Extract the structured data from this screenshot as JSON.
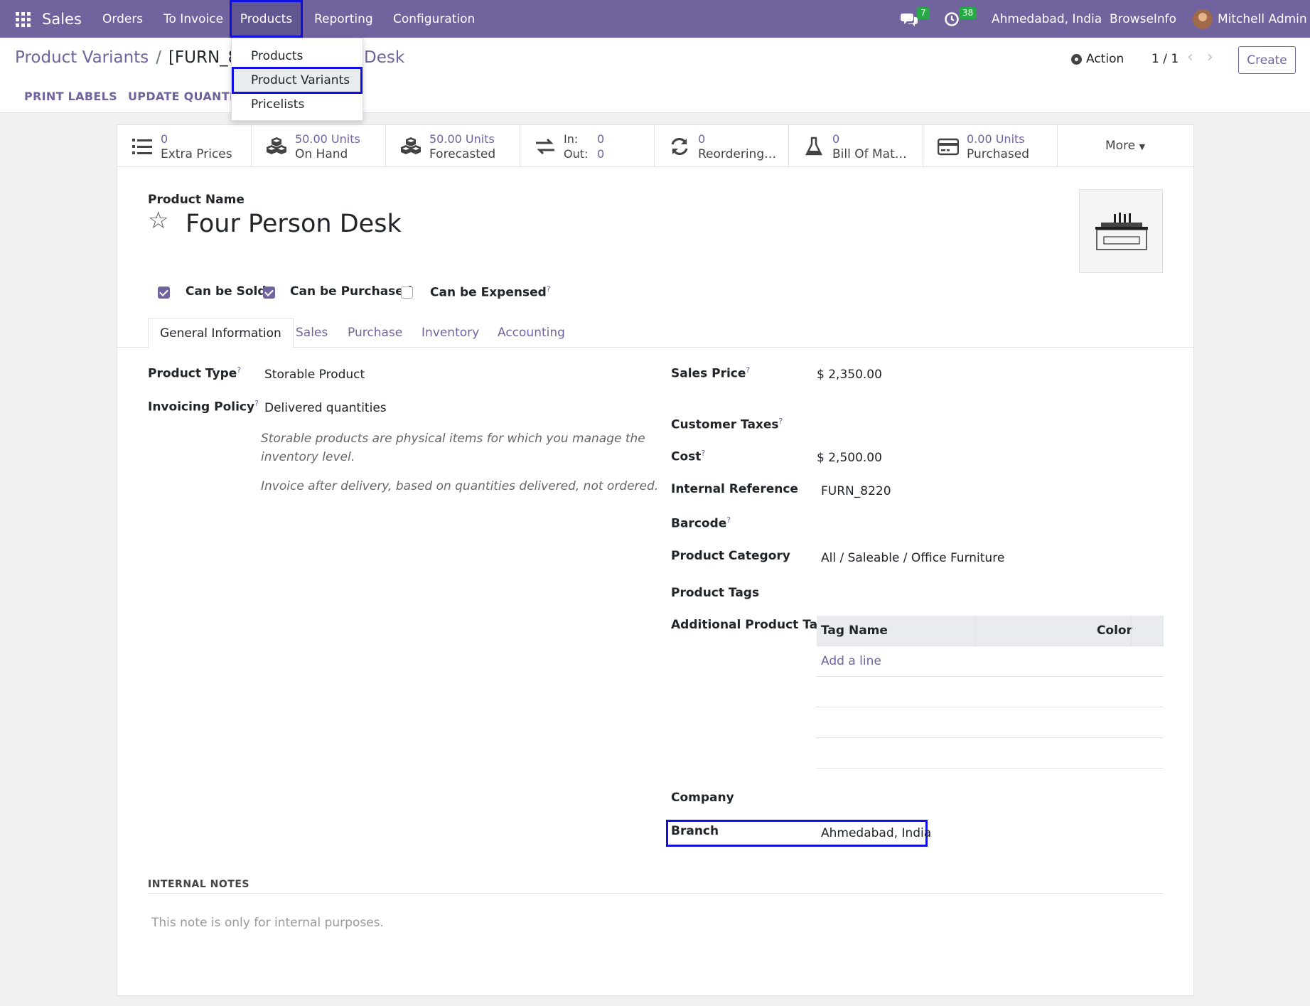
{
  "navbar": {
    "app_name": "Sales",
    "menus": [
      "Orders",
      "To Invoice",
      "Products",
      "Reporting",
      "Configuration"
    ],
    "chat_count": "7",
    "activity_count": "38",
    "branch": "Ahmedabad, India",
    "company": "BrowseInfo",
    "user": "Mitchell Admin"
  },
  "dropdown": {
    "items": [
      "Products",
      "Product Variants",
      "Pricelists"
    ]
  },
  "breadcrumb": {
    "parent": "Product Variants",
    "current_visible": "[FURN_8",
    "current_tail": "Desk"
  },
  "control": {
    "action_label": "Action",
    "pager": "1 / 1",
    "create_label": "Create",
    "print_labels": "PRINT LABELS",
    "update_quantity": "UPDATE QUANTIT"
  },
  "stats": [
    {
      "value": "0",
      "label": "Extra Prices",
      "icon": "list-icon"
    },
    {
      "value": "50.00 Units",
      "label": "On Hand",
      "icon": "cubes-icon"
    },
    {
      "value": "50.00 Units",
      "label": "Forecasted",
      "icon": "cubes-icon"
    },
    {
      "value_in_label": "In:",
      "value_in": "0",
      "value_out_label": "Out:",
      "value_out": "0",
      "icon": "exchange-icon"
    },
    {
      "value": "0",
      "label": "Reordering…",
      "icon": "refresh-icon"
    },
    {
      "value": "0",
      "label": "Bill Of Mat…",
      "icon": "flask-icon"
    },
    {
      "value": "0.00 Units",
      "label": "Purchased",
      "icon": "credit-card-icon"
    }
  ],
  "more_label": "More",
  "product": {
    "name_label": "Product Name",
    "name": "Four Person Desk",
    "can_be_sold": "Can be Sold",
    "can_be_purchased": "Can be Purchased",
    "can_be_expensed": "Can be Expensed"
  },
  "tabs": [
    "General Information",
    "Sales",
    "Purchase",
    "Inventory",
    "Accounting"
  ],
  "left_fields": {
    "product_type_label": "Product Type",
    "product_type": "Storable Product",
    "invoicing_policy_label": "Invoicing Policy",
    "invoicing_policy": "Delivered quantities",
    "help1": "Storable products are physical items for which you manage the",
    "help1b": "inventory level.",
    "help2": "Invoice after delivery, based on quantities delivered, not ordered."
  },
  "right_fields": {
    "sales_price_label": "Sales Price",
    "sales_price": "$ 2,350.00",
    "customer_taxes_label": "Customer Taxes",
    "cost_label": "Cost",
    "cost": "$ 2,500.00",
    "internal_ref_label": "Internal Reference",
    "internal_ref": "FURN_8220",
    "barcode_label": "Barcode",
    "category_label": "Product Category",
    "category": "All / Saleable / Office Furniture",
    "tags_label": "Product Tags",
    "additional_tag_label": "Additional Product Tag",
    "tag_col_name": "Tag Name",
    "tag_col_color": "Color",
    "add_line": "Add a line",
    "company_label": "Company",
    "branch_label": "Branch",
    "branch": "Ahmedabad, India"
  },
  "notes": {
    "title": "INTERNAL NOTES",
    "placeholder": "This note is only for internal purposes."
  },
  "colors": {
    "navbar": "#71639e",
    "accent": "#71639e",
    "highlight": "#1010e0",
    "badge": "#28a745"
  }
}
